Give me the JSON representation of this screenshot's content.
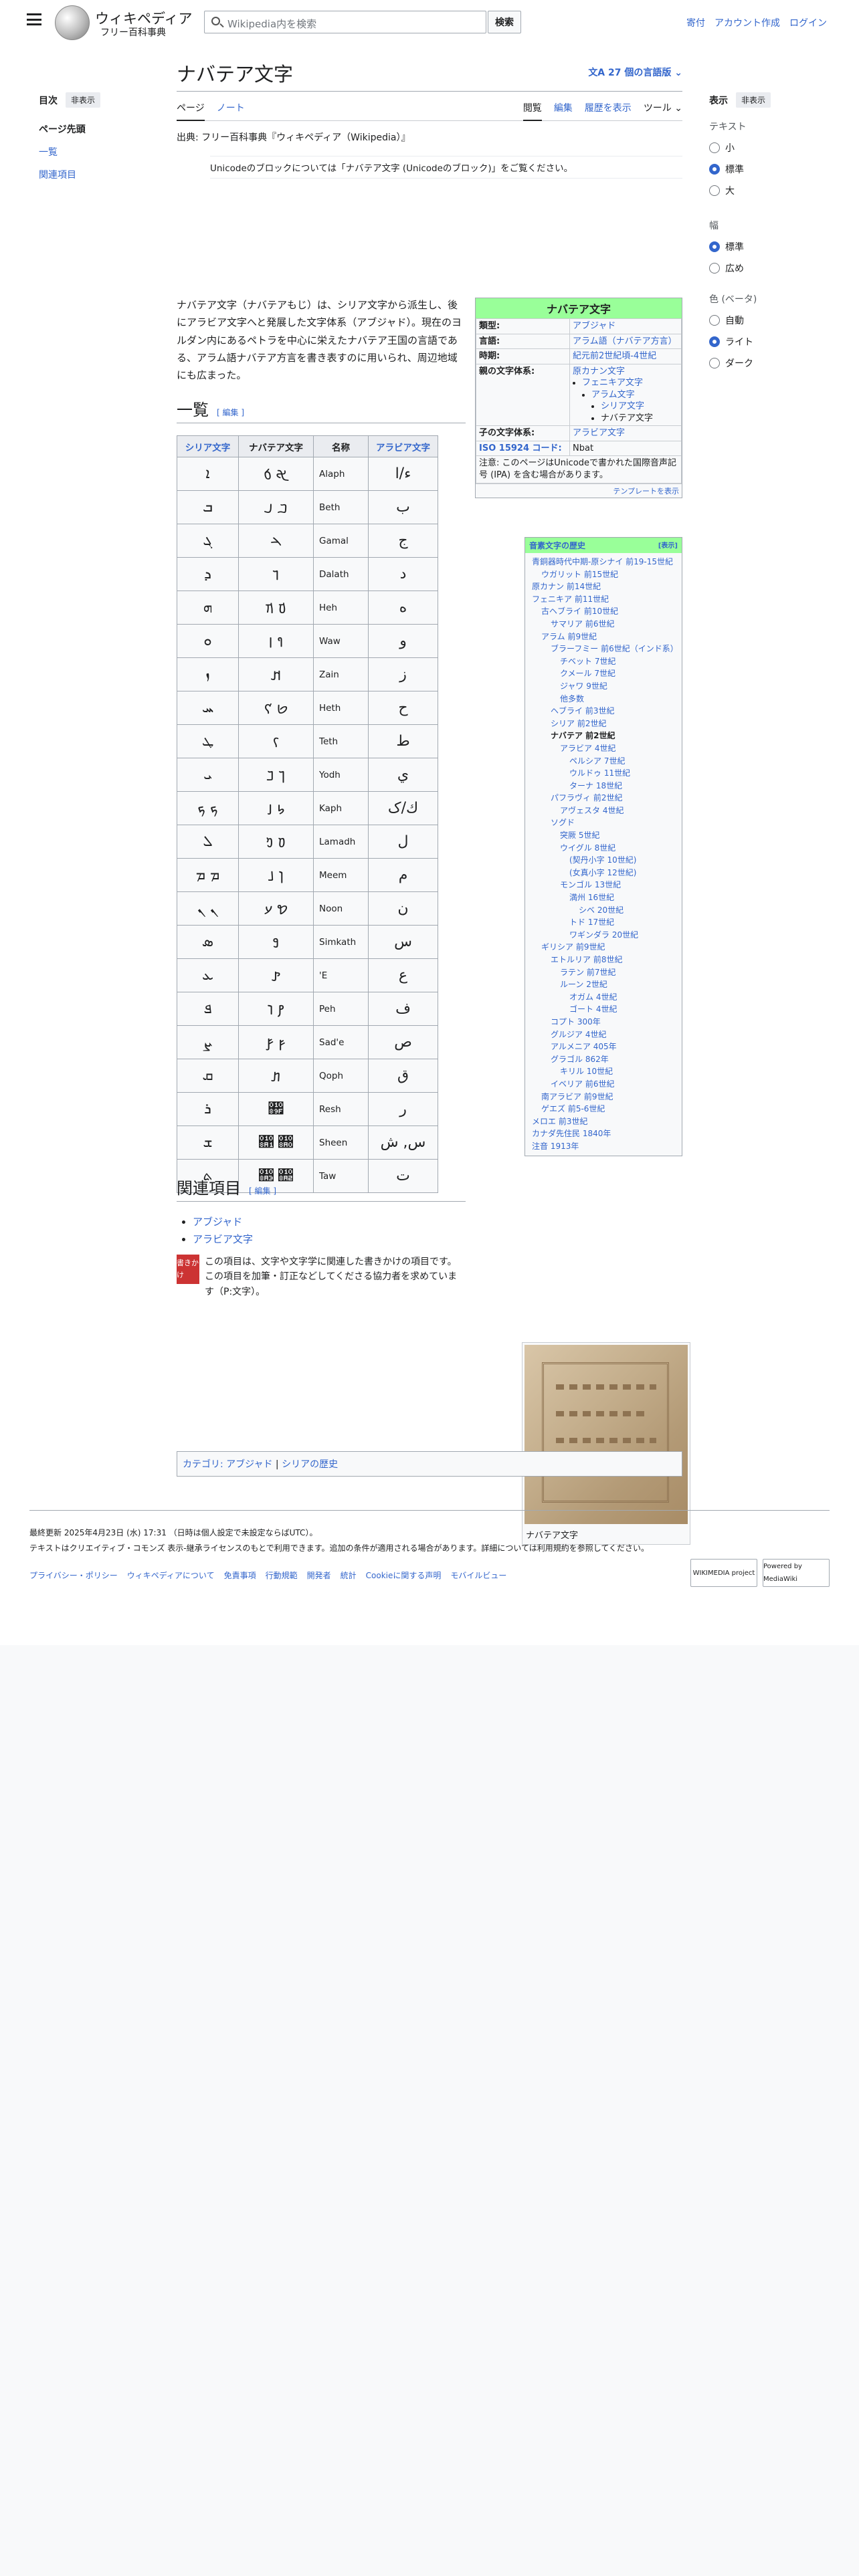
{
  "header": {
    "wordmark": "ウィキペディア",
    "tagline": "フリー百科事典",
    "search_placeholder": "Wikipedia内を検索",
    "search_button": "検索",
    "links": [
      "寄付",
      "アカウント作成",
      "ログイン"
    ]
  },
  "left": {
    "toc": "目次",
    "hide": "非表示",
    "items": [
      "ページ先頭",
      "一覧",
      "関連項目"
    ]
  },
  "page": {
    "title": "ナバテア文字",
    "langs": "27 個の言語版",
    "tabs_left": [
      "ページ",
      "ノート"
    ],
    "tabs_right": [
      "閲覧",
      "編集",
      "履歴を表示",
      "ツール"
    ],
    "from": "出典: フリー百科事典『ウィキペディア（Wikipedia）』",
    "hatnote": "Unicodeのブロックについては「ナバテア文字 (Unicodeのブロック)」をご覧ください。",
    "lead": "ナバテア文字（ナバテアもじ）は、シリア文字から派生し、後にアラビア文字へと発展した文字体系（アブジャド）。現在のヨルダン内にあるペトラを中心に栄えたナバテア王国の言語である、アラム語ナバテア方言を書き表すのに用いられ、周辺地域にも広まった。",
    "sec1": "一覧",
    "edit": "編集",
    "sec2": "関連項目",
    "related": [
      "アブジャド",
      "アラビア文字"
    ],
    "stub": "この項目は、文字や文字学に関連した書きかけの項目です。この項目を加筆・訂正などしてくださる協力者を求めています（P:文字）。",
    "stub_icon": "書きかけ",
    "cats_label": "カテゴリ:",
    "cats": [
      "アブジャド",
      "シリアの歴史"
    ],
    "caption": "ナバテア文字"
  },
  "infobox": {
    "title": "ナバテア文字",
    "rows": [
      [
        "類型:",
        "アブジャド"
      ],
      [
        "言語:",
        "アラム語（ナバテア方言）"
      ],
      [
        "時期:",
        "紀元前2世紀頃-4世紀"
      ],
      [
        "親の文字体系:",
        "原カナン文字"
      ],
      [
        "子の文字体系:",
        "アラビア文字"
      ],
      [
        "ISO 15924 コード:",
        "Nbat"
      ]
    ],
    "parents": [
      "フェニキア文字",
      "アラム文字",
      "シリア文字",
      "ナバテア文字"
    ],
    "note": "注意: このページはUnicodeで書かれた国際音声記号 (IPA) を含む場合があります。",
    "template": "テンプレートを表示"
  },
  "table": {
    "headers": [
      "シリア文字",
      "ナバテア文字",
      "名称",
      "アラビア文字"
    ],
    "rows": [
      [
        "ܐ",
        "𐢀 𐢁",
        "Alaph",
        "ء/ا"
      ],
      [
        "ܒ",
        "𐢂 𐢃",
        "Beth",
        "ب"
      ],
      [
        "ܓ",
        "𐢄",
        "Gamal",
        "ج"
      ],
      [
        "ܕ",
        "𐢅",
        "Dalath",
        "د"
      ],
      [
        "ܗ",
        "𐢆 𐢇",
        "Heh",
        "ه"
      ],
      [
        "ܘ",
        "𐢈 𐢉",
        "Waw",
        "و"
      ],
      [
        "ܙ",
        "𐢊",
        "Zain",
        "ز"
      ],
      [
        "ܚ",
        "𐢋 𐢌",
        "Heth",
        "ح"
      ],
      [
        "ܛ",
        "𐢍",
        "Teth",
        "ط"
      ],
      [
        "ܝ",
        "𐢎 𐢏",
        "Yodh",
        "ي"
      ],
      [
        "ܟ ܟ",
        "𐢐 𐢑",
        "Kaph",
        "ك/ک"
      ],
      [
        "ܠ",
        "𐢒 𐢓",
        "Lamadh",
        "ل"
      ],
      [
        "ܡ ܡ",
        "𐢔 𐢕",
        "Meem",
        "م"
      ],
      [
        "ܢ ܢ",
        "𐢖 𐢗",
        "Noon",
        "ن"
      ],
      [
        "ܣ",
        "𐢘",
        "Simkath",
        "س"
      ],
      [
        "ܥ",
        "𐢙",
        "'E",
        "ع"
      ],
      [
        "ܦ",
        "𐢚 𐢛",
        "Peh",
        "ف"
      ],
      [
        "ܨ",
        "𐢜 𐢝",
        "Sad'e",
        "ص"
      ],
      [
        "ܩ",
        "𐢞",
        "Qoph",
        "ق"
      ],
      [
        "ܪ",
        "𐢟",
        "Resh",
        "ر"
      ],
      [
        "ܫ",
        "𐢠 𐢡",
        "Sheen",
        "س, ش"
      ],
      [
        "ܬ",
        "𐢢 𐢣",
        "Taw",
        "ت"
      ]
    ]
  },
  "navbox": {
    "title": "音素文字の歴史",
    "version": "[表示]",
    "items": [
      "青銅器時代中期-原シナイ 前19-15世紀",
      "ウガリット 前15世紀",
      "原カナン 前14世紀",
      "フェニキア 前11世紀",
      "古ヘブライ 前10世紀",
      "サマリア 前6世紀",
      "アラム 前9世紀",
      "ブラーフミー 前6世紀（インド系）",
      "チベット 7世紀",
      "クメール 7世紀",
      "ジャワ 9世紀",
      "他多数",
      "ヘブライ 前3世紀",
      "シリア 前2世紀",
      "ナバテア 前2世紀",
      "アラビア 4世紀",
      "ペルシア 7世紀",
      "ウルドゥ 11世紀",
      "ターナ 18世紀",
      "パフラヴィ 前2世紀",
      "アヴェスタ 4世紀",
      "ソグド",
      "突厥 5世紀",
      "ウイグル 8世紀",
      "(契丹小字 10世紀)",
      "(女真小字 12世紀)",
      "モンゴル 13世紀",
      "満州 16世紀",
      "シベ 20世紀",
      "トド 17世紀",
      "ワギンダラ 20世紀",
      "ギリシア 前9世紀",
      "エトルリア 前8世紀",
      "ラテン 前7世紀",
      "ルーン 2世紀",
      "オガム 4世紀",
      "ゴート 4世紀",
      "コプト 300年",
      "グルジア 4世紀",
      "アルメニア 405年",
      "グラゴル 862年",
      "キリル 10世紀",
      "イベリア 前6世紀",
      "南アラビア 前9世紀",
      "ゲエズ 前5-6世紀",
      "メロエ 前3世紀",
      "カナダ先住民 1840年",
      "注音 1913年"
    ]
  },
  "right": {
    "display": "表示",
    "hide": "非表示",
    "text": "テキスト",
    "text_opts": [
      "小",
      "標準",
      "大"
    ],
    "width": "幅",
    "width_opts": [
      "標準",
      "広め"
    ],
    "color": "色 (ベータ)",
    "color_opts": [
      "自動",
      "ライト",
      "ダーク"
    ]
  },
  "footer": {
    "updated": "最終更新 2025年4月23日 (水) 17:31 （日時は個人設定で未設定ならばUTC）。",
    "license": "テキストはクリエイティブ・コモンズ 表示-継承ライセンスのもとで利用できます。追加の条件が適用される場合があります。詳細については利用規約を参照してください。",
    "links": [
      "プライバシー・ポリシー",
      "ウィキペディアについて",
      "免責事項",
      "行動規範",
      "開発者",
      "統計",
      "Cookieに関する声明",
      "モバイルビュー"
    ],
    "badge1": "WIKIMEDIA project",
    "badge2": "Powered by MediaWiki"
  }
}
